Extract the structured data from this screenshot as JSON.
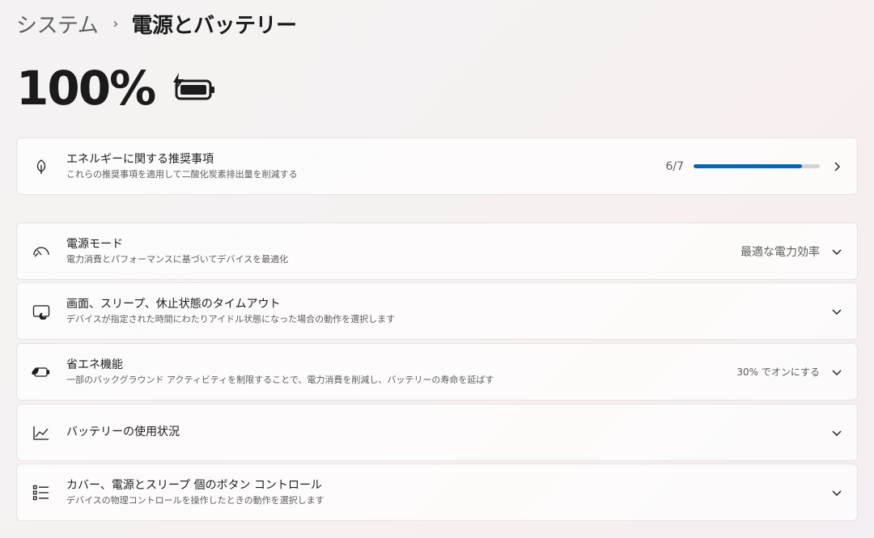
{
  "breadcrumb": {
    "parent": "システム",
    "separator": "›",
    "current": "電源とバッテリー"
  },
  "battery": {
    "percent_label": "100%",
    "icon": "battery-charging-icon"
  },
  "accent_color": "#0067c0",
  "cards": [
    {
      "id": "energy",
      "title": "エネルギーに関する推奨事項",
      "desc": "これらの推奨事項を適用して二酸化炭素排出量を削減する",
      "icon": "leaf-icon",
      "progress_label": "6/7",
      "progress_fraction": 0.857,
      "action": "chevron-right-icon"
    },
    {
      "id": "power-mode",
      "title": "電源モード",
      "desc": "電力消費とパフォーマンスに基づいてデバイスを最適化",
      "icon": "power-mode-gauge-icon",
      "value": "最適な電力効率",
      "action": "chevron-down-icon"
    },
    {
      "id": "screen-sleep",
      "title": "画面、スリープ、休止状態のタイムアウト",
      "desc": "デバイスが指定された時間にわたりアイドル状態になった場合の動作を選択します",
      "icon": "screen-sleep-icon",
      "action": "chevron-down-icon"
    },
    {
      "id": "energy-saver",
      "title": "省エネ機能",
      "desc": "一部のバックグラウンド アクティビティを制限することで、電力消費を削減し、バッテリーの寿命を延ばす",
      "icon": "battery-saver-icon",
      "value": "30% でオンにする",
      "action": "chevron-down-icon"
    },
    {
      "id": "battery-usage",
      "title": "バッテリーの使用状況",
      "icon": "chart-line-icon",
      "action": "chevron-down-icon"
    },
    {
      "id": "buttons",
      "title": "カバー、電源とスリープ 個のボタン コントロール",
      "desc": "デバイスの物理コントロールを操作したときの動作を選択します",
      "icon": "button-controls-icon",
      "action": "chevron-down-icon"
    }
  ]
}
